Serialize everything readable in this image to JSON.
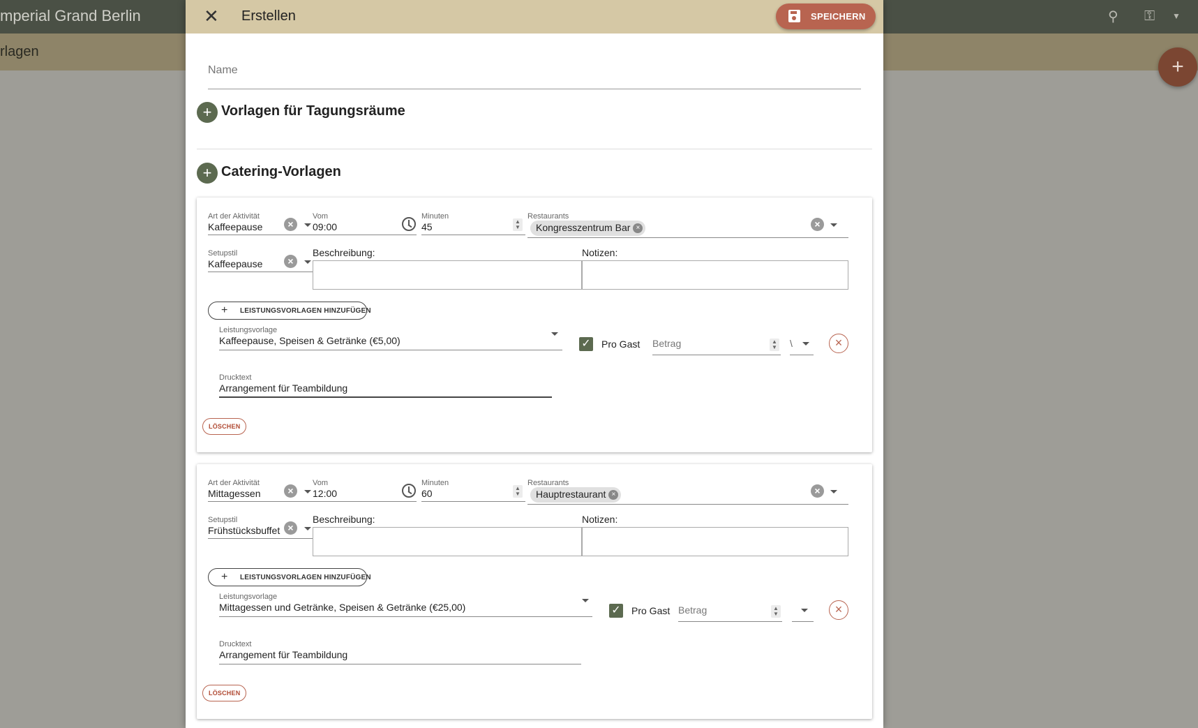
{
  "background": {
    "app_title": "mperial Grand Berlin",
    "page_title": "rlagen",
    "add_label": "+"
  },
  "dialog": {
    "close_label": "✕",
    "title": "Erstellen",
    "save_label": "SPEICHERN",
    "name_placeholder": "Name",
    "add_label": "+",
    "sections": {
      "rooms_title": "Vorlagen für Tagungsräume",
      "catering_title": "Catering-Vorlagen"
    }
  },
  "cards": [
    {
      "activity_label": "Art der Aktivität",
      "activity_value": "Kaffeepause",
      "from_label": "Vom",
      "from_value": "09:00",
      "minutes_label": "Minuten",
      "minutes_value": "45",
      "restaurants_label": "Restaurants",
      "restaurant_chip": "Kongresszentrum Bar",
      "setup_label": "Setupstil",
      "setup_value": "Kaffeepause",
      "description_label": "Beschreibung:",
      "notes_label": "Notizen:",
      "add_templates_label": "LEISTUNGSVORLAGEN HINZUFÜGEN",
      "service_label": "Leistungsvorlage",
      "service_value": "Kaffeepause, Speisen & Getränke (€5,00)",
      "per_guest_label": "Pro Gast",
      "per_guest_checked": true,
      "amount_placeholder": "Betrag",
      "unit_value": "\\",
      "print_label": "Drucktext",
      "print_value": "Arrangement für Teambildung",
      "delete_label": "LÖSCHEN"
    },
    {
      "activity_label": "Art der Aktivität",
      "activity_value": "Mittagessen",
      "from_label": "Vom",
      "from_value": "12:00",
      "minutes_label": "Minuten",
      "minutes_value": "60",
      "restaurants_label": "Restaurants",
      "restaurant_chip": "Hauptrestaurant",
      "setup_label": "Setupstil",
      "setup_value": "Frühstücksbuffet",
      "description_label": "Beschreibung:",
      "notes_label": "Notizen:",
      "add_templates_label": "LEISTUNGSVORLAGEN HINZUFÜGEN",
      "service_label": "Leistungsvorlage",
      "service_value": "Mittagessen und Getränke, Speisen & Getränke (€25,00)",
      "per_guest_label": "Pro Gast",
      "per_guest_checked": true,
      "amount_placeholder": "Betrag",
      "unit_value": "",
      "print_label": "Drucktext",
      "print_value": "Arrangement für Teambildung",
      "delete_label": "LÖSCHEN"
    }
  ],
  "colors": {
    "accent": "#5c6a50",
    "danger": "#b86450",
    "header": "#d5c8a5"
  }
}
